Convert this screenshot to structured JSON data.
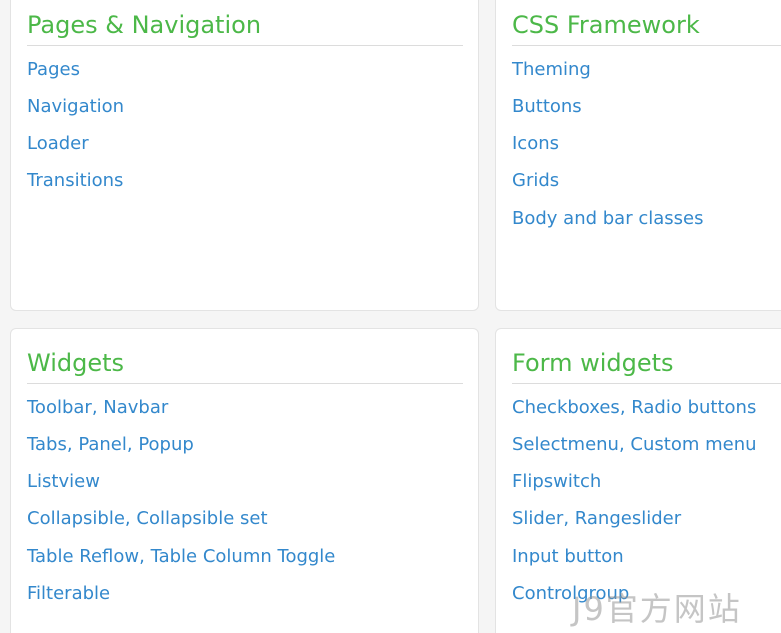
{
  "cards": [
    {
      "title": "Pages & Navigation",
      "links": [
        "Pages",
        "Navigation",
        "Loader",
        "Transitions"
      ]
    },
    {
      "title": "CSS Framework",
      "links": [
        "Theming",
        "Buttons",
        "Icons",
        "Grids",
        "Body and bar classes"
      ]
    },
    {
      "title": "Widgets",
      "links": [
        [
          "Toolbar",
          "Navbar"
        ],
        [
          "Tabs",
          "Panel",
          "Popup"
        ],
        [
          "Listview"
        ],
        [
          "Collapsible",
          "Collapsible set"
        ],
        [
          "Table Reflow",
          "Table Column Toggle"
        ],
        [
          "Filterable"
        ]
      ]
    },
    {
      "title": "Form widgets",
      "links": [
        [
          "Checkboxes",
          "Radio buttons"
        ],
        [
          "Selectmenu",
          "Custom menu"
        ],
        [
          "Flipswitch"
        ],
        [
          "Slider",
          "Rangeslider"
        ],
        [
          "Input button"
        ],
        [
          "Controlgroup"
        ]
      ]
    }
  ],
  "watermark": "J9官方网站",
  "colors": {
    "title": "#4cb848",
    "link": "#3388cc",
    "card_border": "#e3e3e3",
    "rule": "#dcdcdc",
    "background": "#f5f5f5"
  }
}
